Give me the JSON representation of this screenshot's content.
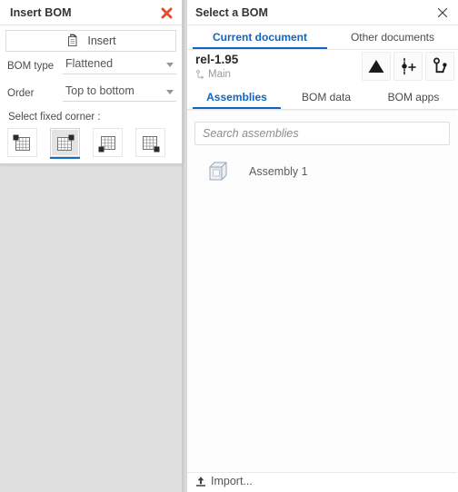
{
  "insert_bom": {
    "title": "Insert BOM",
    "close_icon": "close-x-icon",
    "close_color": "#e04e2a",
    "insert_button": {
      "label": "Insert",
      "icon": "insert-table-icon"
    },
    "fields": [
      {
        "label": "BOM type",
        "value": "Flattened",
        "caret_icon": "chevron-down-icon"
      },
      {
        "label": "Order",
        "value": "Top to bottom",
        "caret_icon": "chevron-down-icon"
      }
    ],
    "fixed_corner": {
      "caption": "Select fixed corner :",
      "selected_index": 1,
      "accent": "#1070c8",
      "options": [
        {
          "name": "corner-top-left",
          "icon": "grid-corner-top-left-icon"
        },
        {
          "name": "corner-top-right",
          "icon": "grid-corner-top-right-icon"
        },
        {
          "name": "corner-bottom-left",
          "icon": "grid-corner-bottom-left-icon"
        },
        {
          "name": "corner-bottom-right",
          "icon": "grid-corner-bottom-right-icon"
        }
      ]
    }
  },
  "select_bom": {
    "title": "Select a BOM",
    "close_icon": "close-x-icon",
    "document_tabs": [
      {
        "label": "Current document",
        "active": true
      },
      {
        "label": "Other documents",
        "active": false
      }
    ],
    "release": {
      "name": "rel-1.95",
      "branch": "Main",
      "branch_icon": "branch-icon",
      "actions": [
        {
          "name": "release-triangle-button",
          "icon": "triangle-up-icon"
        },
        {
          "name": "add-version-button",
          "icon": "add-version-icon"
        },
        {
          "name": "branch-button",
          "icon": "branch-icon"
        }
      ]
    },
    "section_tabs": [
      {
        "label": "Assemblies",
        "active": true
      },
      {
        "label": "BOM data",
        "active": false
      },
      {
        "label": "BOM apps",
        "active": false
      }
    ],
    "search": {
      "value": "",
      "placeholder": "Search assemblies"
    },
    "assemblies": [
      {
        "label": "Assembly 1",
        "icon": "cube-part-icon"
      }
    ],
    "footer": {
      "import_label": "Import...",
      "import_icon": "upload-icon"
    },
    "accent": "#1065c0"
  }
}
